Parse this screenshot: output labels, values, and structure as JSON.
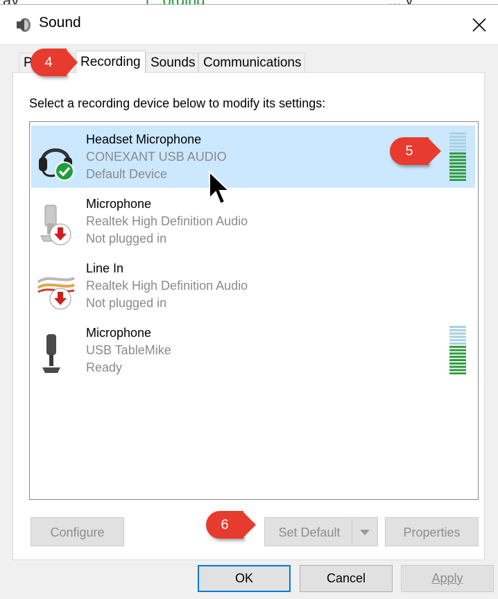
{
  "clipped_top_text": {
    "left": "ay",
    "green": "r...ording",
    "right": "... y",
    "note": ""
  },
  "window": {
    "title": "Sound",
    "icon": "speaker-icon",
    "close_icon": "close-icon"
  },
  "tabs": [
    {
      "label": "P",
      "active": false
    },
    {
      "label": "Recording",
      "active": true
    },
    {
      "label": "Sounds",
      "active": false
    },
    {
      "label": "Communications",
      "active": false
    }
  ],
  "instruction": "Select a recording device below to modify its settings:",
  "devices": [
    {
      "name": "Headset Microphone",
      "driver": "CONEXANT USB AUDIO",
      "status": "Default Device",
      "icon": "headset-icon",
      "badge": "checkmark-badge-icon",
      "selected": true,
      "level": 0.6
    },
    {
      "name": "Microphone",
      "driver": "Realtek High Definition Audio",
      "status": "Not plugged in",
      "icon": "microphone-icon",
      "badge": "down-arrow-badge-icon",
      "selected": false,
      "level": null
    },
    {
      "name": "Line In",
      "driver": "Realtek High Definition Audio",
      "status": "Not plugged in",
      "icon": "line-in-cable-icon",
      "badge": "down-arrow-badge-icon",
      "selected": false,
      "level": null
    },
    {
      "name": "Microphone",
      "driver": "USB TableMike",
      "status": "Ready",
      "icon": "desk-microphone-icon",
      "badge": null,
      "selected": false,
      "level": 0.6
    }
  ],
  "buttons": {
    "configure": "Configure",
    "set_default": "Set Default",
    "properties": "Properties",
    "ok": "OK",
    "cancel": "Cancel",
    "apply": "Apply"
  },
  "callouts": {
    "step4": "4",
    "step5": "5",
    "step6": "6"
  },
  "colors": {
    "selection": "#cce8ff",
    "callout": "#e63b2e",
    "meter_active": "#2e9a3a",
    "meter_inactive": "#a8d0e0",
    "accent": "#0078d7"
  }
}
